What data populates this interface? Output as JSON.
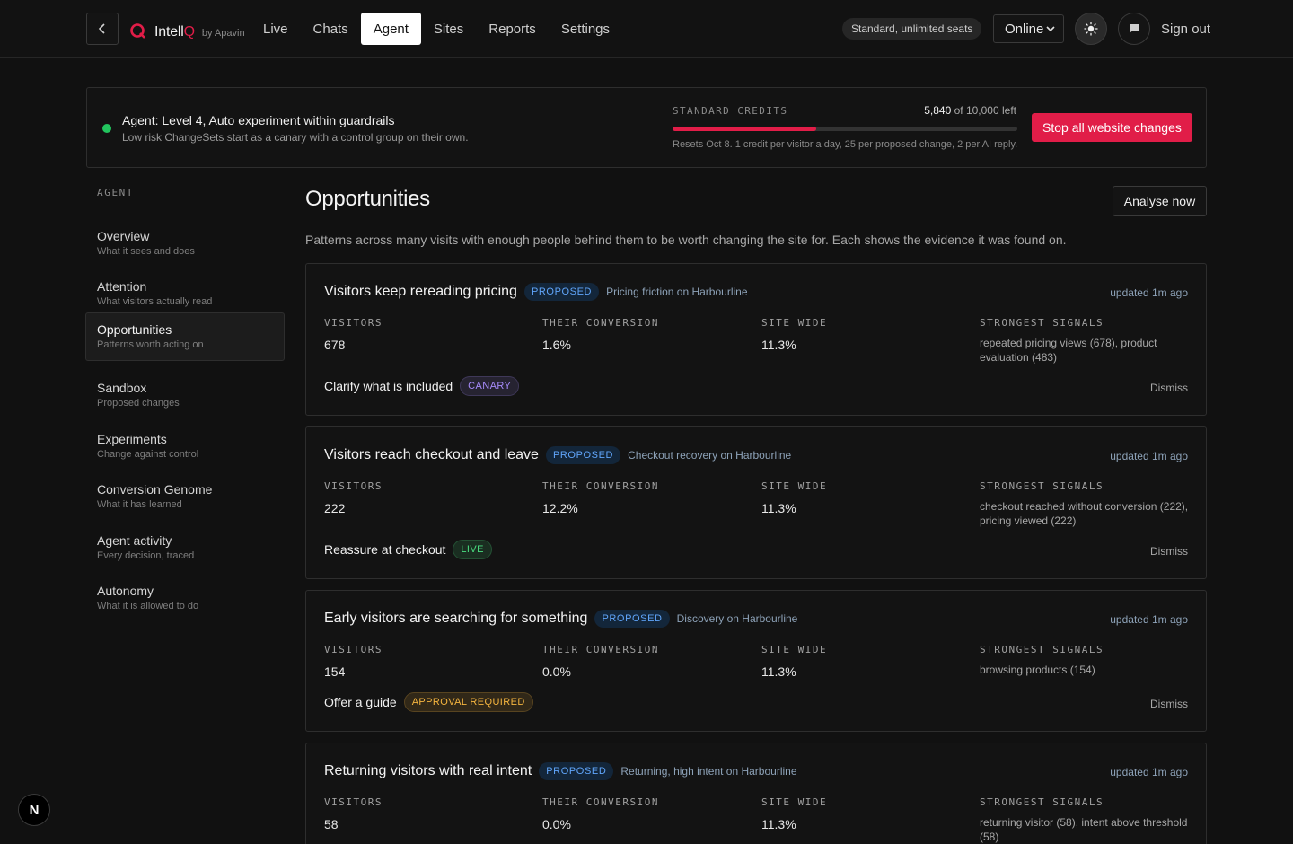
{
  "header": {
    "brand_name_prefix": "Intell",
    "brand_name_suffix": "Q",
    "brand_by": "by Apavin",
    "nav": [
      {
        "label": "Live",
        "active": false
      },
      {
        "label": "Chats",
        "active": false
      },
      {
        "label": "Agent",
        "active": true
      },
      {
        "label": "Sites",
        "active": false
      },
      {
        "label": "Reports",
        "active": false
      },
      {
        "label": "Settings",
        "active": false
      }
    ],
    "plan": "Standard, unlimited seats",
    "status_value": "Online",
    "sign_out": "Sign out"
  },
  "banner": {
    "title": "Agent: Level 4, Auto experiment within guardrails",
    "subtitle": "Low risk ChangeSets start as a canary with a control group on their own.",
    "credits_label": "STANDARD CREDITS",
    "credits_remaining": "5,840",
    "credits_of": "of 10,000 left",
    "credits_fraction_used": 0.416,
    "credits_note": "Resets Oct 8. 1 credit per visitor a day, 25 per proposed change, 2 per AI reply.",
    "stop_button": "Stop all website changes"
  },
  "sidebar": {
    "heading": "AGENT",
    "items": [
      {
        "label": "Overview",
        "desc": "What it sees and does",
        "active": false
      },
      {
        "label": "Attention",
        "desc": "What visitors actually read",
        "active": false
      },
      {
        "label": "Opportunities",
        "desc": "Patterns worth acting on",
        "active": true
      },
      {
        "label": "Sandbox",
        "desc": "Proposed changes",
        "active": false
      },
      {
        "label": "Experiments",
        "desc": "Change against control",
        "active": false
      },
      {
        "label": "Conversion Genome",
        "desc": "What it has learned",
        "active": false
      },
      {
        "label": "Agent activity",
        "desc": "Every decision, traced",
        "active": false
      },
      {
        "label": "Autonomy",
        "desc": "What it is allowed to do",
        "active": false
      }
    ]
  },
  "main": {
    "title": "Opportunities",
    "analyse_button": "Analyse now",
    "intro": "Patterns across many visits with enough people behind them to be worth changing the site for. Each shows the evidence it was found on.",
    "stat_labels": {
      "visitors": "VISITORS",
      "their_conversion": "THEIR CONVERSION",
      "site_wide": "SITE WIDE",
      "signals": "STRONGEST SIGNALS"
    },
    "dismiss_label": "Dismiss",
    "cards": [
      {
        "title": "Visitors keep rereading pricing",
        "status": "PROPOSED",
        "context": "Pricing friction on Harbourline",
        "updated": "updated 1m ago",
        "visitors": "678",
        "their_conversion": "1.6%",
        "site_wide": "11.3%",
        "signals": "repeated pricing views (678), product evaluation (483)",
        "action": "Clarify what is included",
        "action_badge": "CANARY",
        "action_badge_color": "#a78bfa"
      },
      {
        "title": "Visitors reach checkout and leave",
        "status": "PROPOSED",
        "context": "Checkout recovery on Harbourline",
        "updated": "updated 1m ago",
        "visitors": "222",
        "their_conversion": "12.2%",
        "site_wide": "11.3%",
        "signals": "checkout reached without conversion (222), pricing viewed (222)",
        "action": "Reassure at checkout",
        "action_badge": "LIVE",
        "action_badge_color": "#4ade80"
      },
      {
        "title": "Early visitors are searching for something",
        "status": "PROPOSED",
        "context": "Discovery on Harbourline",
        "updated": "updated 1m ago",
        "visitors": "154",
        "their_conversion": "0.0%",
        "site_wide": "11.3%",
        "signals": "browsing products (154)",
        "action": "Offer a guide",
        "action_badge": "APPROVAL REQUIRED",
        "action_badge_color": "#f5b53f"
      },
      {
        "title": "Returning visitors with real intent",
        "status": "PROPOSED",
        "context": "Returning, high intent on Harbourline",
        "updated": "updated 1m ago",
        "visitors": "58",
        "their_conversion": "0.0%",
        "site_wide": "11.3%",
        "signals": "returning visitor (58), intent above threshold (58)",
        "action": "",
        "action_badge": "",
        "action_badge_color": ""
      }
    ]
  },
  "fab_label": "N",
  "colors": {
    "accent": "#e11d48",
    "active_dot": "#22c55e",
    "proposed": "#60a5fa"
  }
}
